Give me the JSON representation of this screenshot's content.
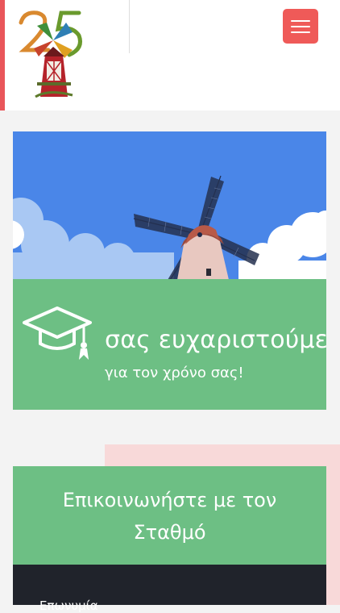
{
  "header": {
    "logo_alt": "25",
    "menu_icon": "hamburger-menu-icon"
  },
  "hero": {
    "illustration": "windmill",
    "title": "σας ευχαριστούμε",
    "subtitle": "για τον χρόνο σας!",
    "icon": "graduation-cap-icon"
  },
  "contact": {
    "title_line1": "Επικοινωνήστε με τον",
    "title_line2": "Σταθμό",
    "field_label": "Επωνυμία"
  },
  "colors": {
    "accent_red": "#e9565a",
    "menu_red": "#ef5a58",
    "green": "#6dbf84",
    "sky_blue": "#4a86e8",
    "pink": "#f8d9d9",
    "dark": "#20232b"
  }
}
